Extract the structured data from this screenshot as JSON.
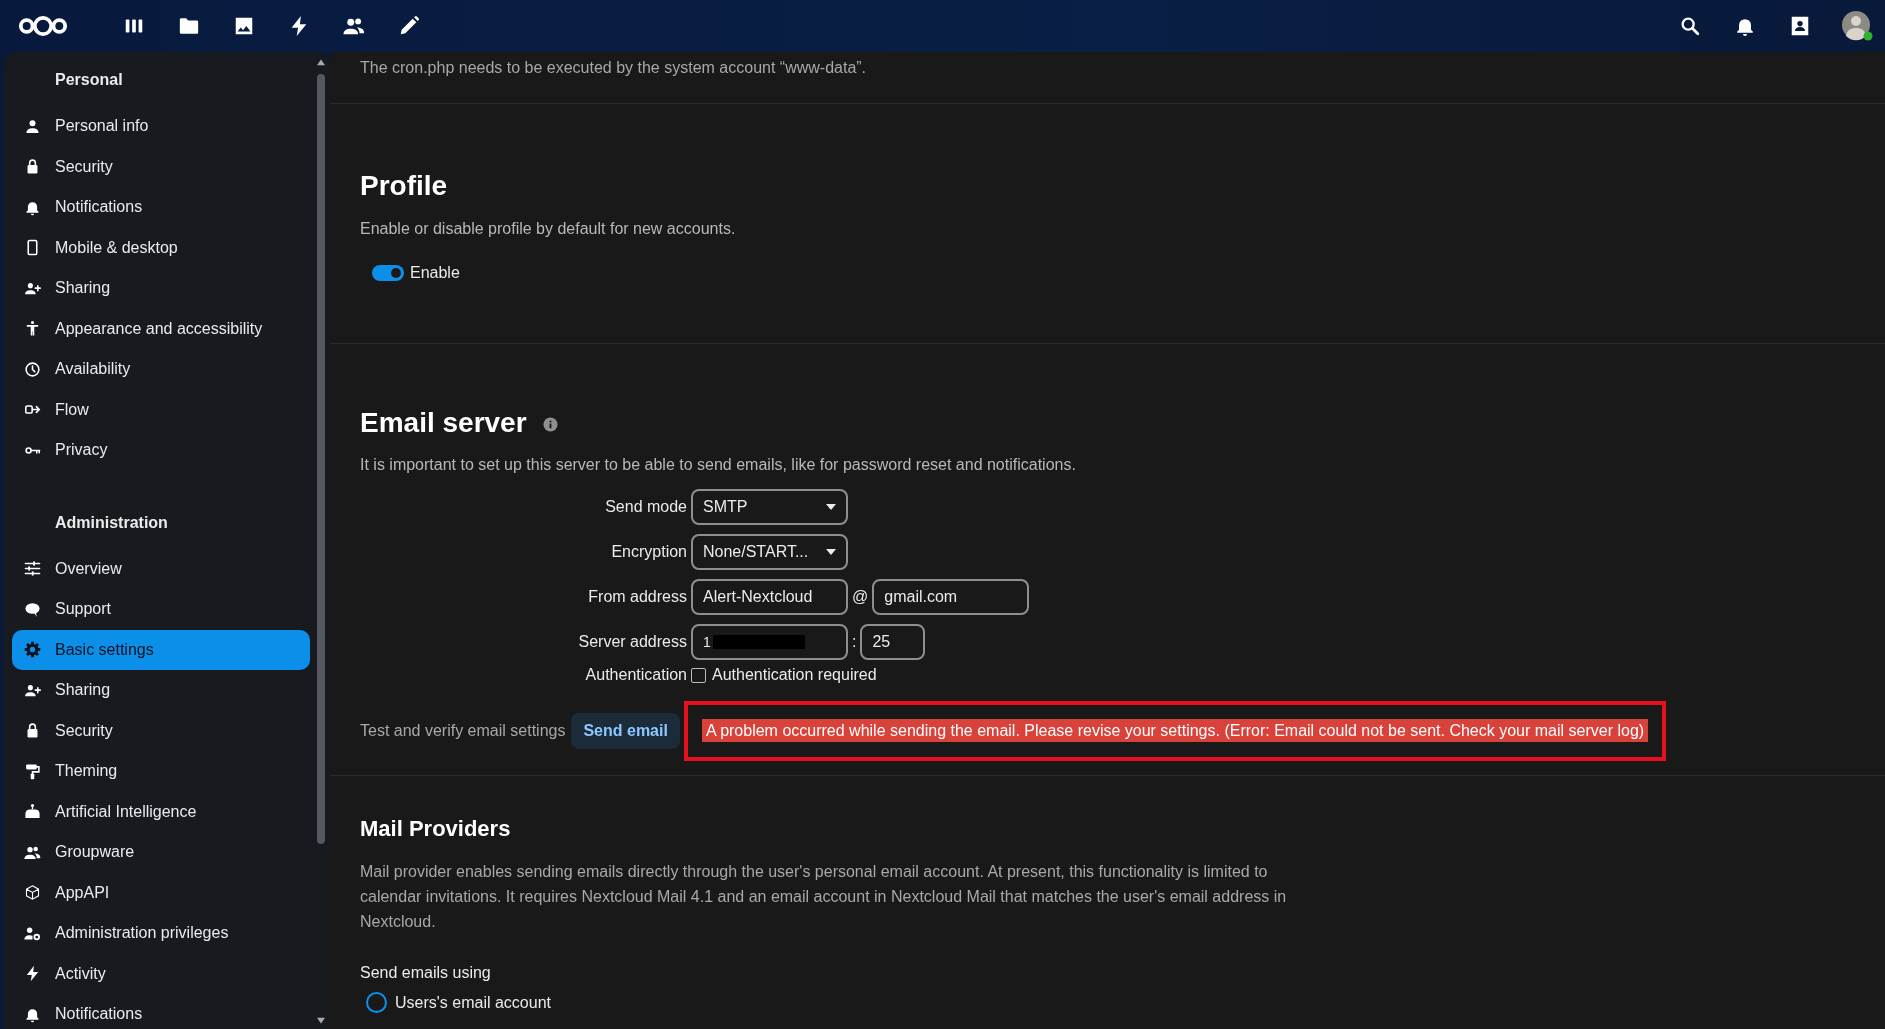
{
  "sidebar": {
    "sections": [
      {
        "title": "Personal",
        "items": [
          {
            "label": "Personal info",
            "selected": false
          },
          {
            "label": "Security",
            "selected": false
          },
          {
            "label": "Notifications",
            "selected": false
          },
          {
            "label": "Mobile & desktop",
            "selected": false
          },
          {
            "label": "Sharing",
            "selected": false
          },
          {
            "label": "Appearance and accessibility",
            "selected": false
          },
          {
            "label": "Availability",
            "selected": false
          },
          {
            "label": "Flow",
            "selected": false
          },
          {
            "label": "Privacy",
            "selected": false
          }
        ]
      },
      {
        "title": "Administration",
        "items": [
          {
            "label": "Overview",
            "selected": false
          },
          {
            "label": "Support",
            "selected": false
          },
          {
            "label": "Basic settings",
            "selected": true
          },
          {
            "label": "Sharing",
            "selected": false
          },
          {
            "label": "Security",
            "selected": false
          },
          {
            "label": "Theming",
            "selected": false
          },
          {
            "label": "Artificial Intelligence",
            "selected": false
          },
          {
            "label": "Groupware",
            "selected": false
          },
          {
            "label": "AppAPI",
            "selected": false
          },
          {
            "label": "Administration privileges",
            "selected": false
          },
          {
            "label": "Activity",
            "selected": false
          },
          {
            "label": "Notifications",
            "selected": false
          }
        ]
      }
    ]
  },
  "cron_note": "The cron.php needs to be executed by the system account “www-data”.",
  "profile": {
    "title": "Profile",
    "description": "Enable or disable profile by default for new accounts.",
    "toggle": {
      "label": "Enable",
      "on": true
    }
  },
  "email_server": {
    "title": "Email server",
    "description": "It is important to set up this server to be able to send emails, like for password reset and notifications.",
    "fields": [
      {
        "kind": "select",
        "label": "Send mode",
        "value": "SMTP"
      },
      {
        "kind": "select",
        "label": "Encryption",
        "value": "None/START..."
      },
      {
        "kind": "pair",
        "label": "From address",
        "separator": "@",
        "values": [
          {
            "value": "Alert-Nextcloud",
            "redacted": false
          },
          {
            "value": "gmail.com",
            "redacted": false
          }
        ]
      },
      {
        "kind": "pair",
        "label": "Server address",
        "separator": ":",
        "values": [
          {
            "value": "1",
            "redacted": true
          },
          {
            "value": "25",
            "redacted": false
          }
        ]
      },
      {
        "kind": "checkbox",
        "label": "Authentication",
        "text": "Authentication required",
        "checked": false
      }
    ],
    "test": {
      "label": "Test and verify email settings",
      "button": "Send email",
      "error": "A problem occurred while sending the email. Please revise your settings. (Error: Email could not be sent. Check your mail server log)",
      "highlighted": true
    }
  },
  "mail_providers": {
    "title": "Mail Providers",
    "description": "Mail provider enables sending emails directly through the user's personal email account. At present, this functionality is limited to calendar invitations. It requires Nextcloud Mail 4.1 and an email account in Nextcloud Mail that matches the user's email address in Nextcloud.",
    "send_label": "Send emails using",
    "options": [
      {
        "label": "Users's email account",
        "selected": false
      }
    ]
  }
}
